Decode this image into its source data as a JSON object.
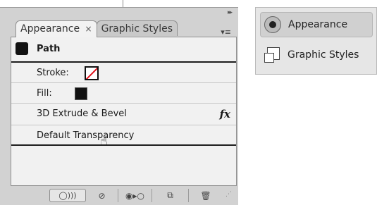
{
  "panel": {
    "tabs": [
      {
        "label": "Appearance",
        "close": "×"
      },
      {
        "label": "Graphic Styles"
      }
    ],
    "grip": "▸▸",
    "menu_icon": "▾≡"
  },
  "object": {
    "label": "Path"
  },
  "attributes": {
    "stroke_label": "Stroke:",
    "fill_label": "Fill:",
    "effect_label": "3D Extrude & Bevel",
    "effect_icon": "fx",
    "transparency_label": "Default Transparency"
  },
  "bottom_bar": {
    "new_art_icon": "◯)))",
    "clear_icon": "⊘",
    "reduce_icon": "◉▸○",
    "duplicate_icon": "⧉",
    "delete_icon": "🗑"
  },
  "dock": {
    "items": [
      {
        "label": "Appearance",
        "icon": "appearance-icon",
        "selected": true
      },
      {
        "label": "Graphic Styles",
        "icon": "graphic-styles-icon",
        "selected": false
      }
    ]
  },
  "colors": {
    "panel_bg": "#d2d2d2",
    "content_bg": "#f1f1f1",
    "stroke_slash": "#e0101a",
    "fill": "#111111"
  }
}
